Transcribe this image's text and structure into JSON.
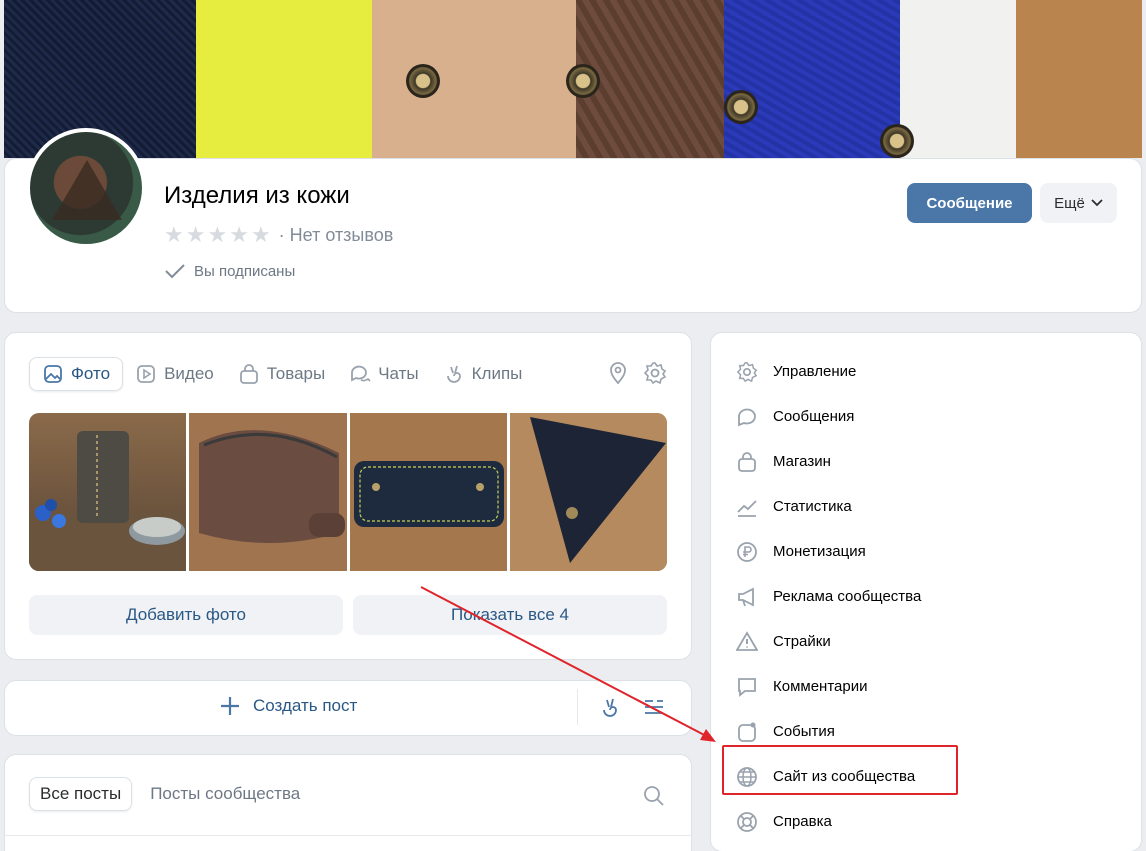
{
  "header": {
    "title": "Изделия из кожи",
    "reviews": "· Нет отзывов",
    "subscribed": "Вы подписаны",
    "message_button": "Сообщение",
    "more_button": "Ещё"
  },
  "media": {
    "tabs": [
      {
        "label": "Фото",
        "icon": "photo-icon"
      },
      {
        "label": "Видео",
        "icon": "video-icon"
      },
      {
        "label": "Товары",
        "icon": "bag-icon"
      },
      {
        "label": "Чаты",
        "icon": "chats-icon"
      },
      {
        "label": "Клипы",
        "icon": "clips-icon"
      }
    ],
    "add_photo": "Добавить фото",
    "show_all": "Показать все 4"
  },
  "post": {
    "create": "Создать пост"
  },
  "feed": {
    "all_posts": "Все посты",
    "community_posts": "Посты сообщества"
  },
  "menu": {
    "items": [
      {
        "label": "Управление",
        "icon": "gear-icon"
      },
      {
        "label": "Сообщения",
        "icon": "chat-bubble-icon"
      },
      {
        "label": "Магазин",
        "icon": "shop-bag-icon"
      },
      {
        "label": "Статистика",
        "icon": "stats-icon"
      },
      {
        "label": "Монетизация",
        "icon": "ruble-icon"
      },
      {
        "label": "Реклама сообщества",
        "icon": "megaphone-icon"
      },
      {
        "label": "Страйки",
        "icon": "warning-icon"
      },
      {
        "label": "Комментарии",
        "icon": "comment-icon"
      },
      {
        "label": "События",
        "icon": "events-icon"
      },
      {
        "label": "Сайт из сообщества",
        "icon": "globe-icon"
      },
      {
        "label": "Справка",
        "icon": "lifebuoy-icon"
      }
    ]
  },
  "colors": {
    "accent": "#4a76a8",
    "link": "#2a5885",
    "annotation": "#e0242b"
  }
}
